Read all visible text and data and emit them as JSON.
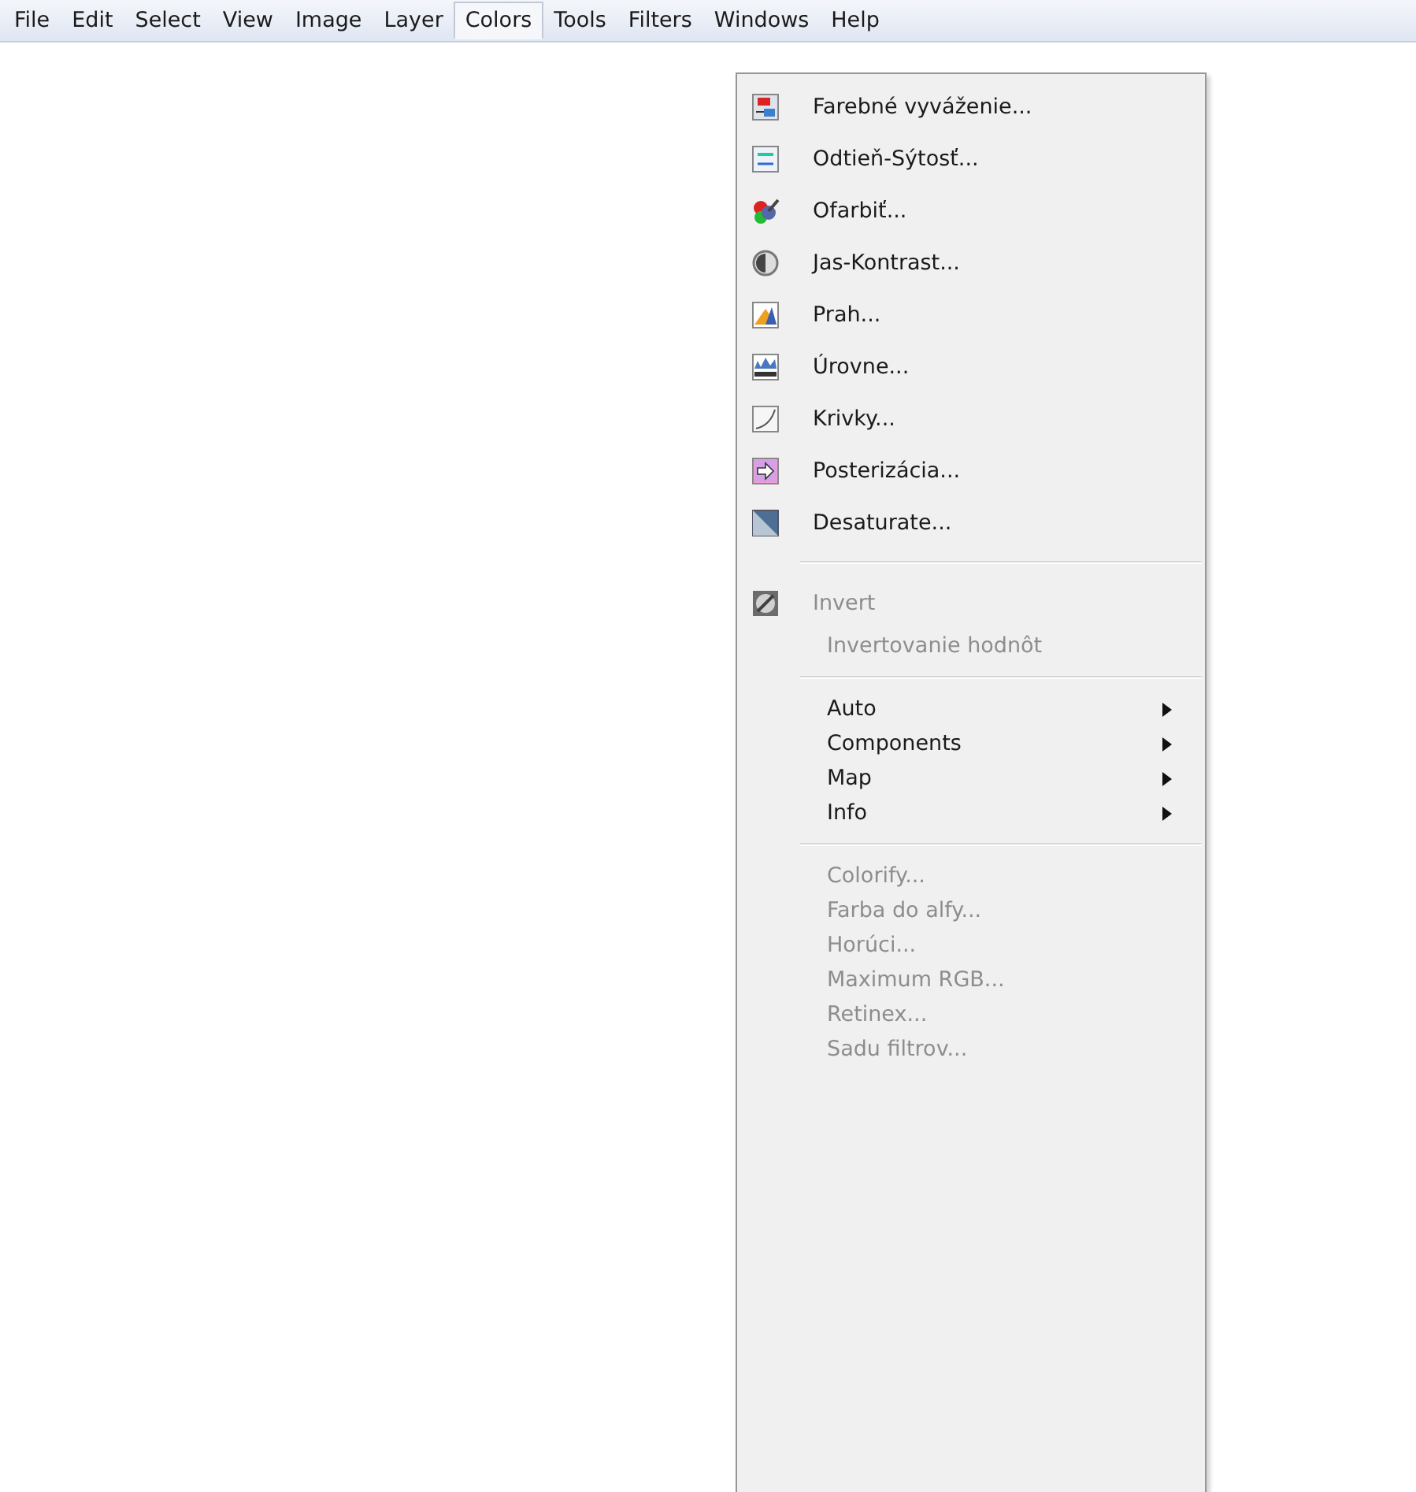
{
  "menubar": [
    {
      "label": "File",
      "selected": false
    },
    {
      "label": "Edit",
      "selected": false
    },
    {
      "label": "Select",
      "selected": false
    },
    {
      "label": "View",
      "selected": false
    },
    {
      "label": "Image",
      "selected": false
    },
    {
      "label": "Layer",
      "selected": false
    },
    {
      "label": "Colors",
      "selected": true
    },
    {
      "label": "Tools",
      "selected": false
    },
    {
      "label": "Filters",
      "selected": false
    },
    {
      "label": "Windows",
      "selected": false
    },
    {
      "label": "Help",
      "selected": false
    }
  ],
  "menu": {
    "groups": [
      [
        {
          "kind": "icon",
          "label": "Farebné vyváženie...",
          "disabled": false
        },
        {
          "kind": "icon",
          "label": "Odtieň-Sýtosť...",
          "disabled": false
        },
        {
          "kind": "icon",
          "label": "Ofarbiť...",
          "disabled": false
        },
        {
          "kind": "icon",
          "label": "Jas-Kontrast...",
          "disabled": false
        },
        {
          "kind": "icon",
          "label": "Prah...",
          "disabled": false
        },
        {
          "kind": "icon",
          "label": "Úrovne...",
          "disabled": false
        },
        {
          "kind": "icon",
          "label": "Krivky...",
          "disabled": false
        },
        {
          "kind": "icon",
          "label": "Posterizácia...",
          "disabled": false
        },
        {
          "kind": "icon",
          "label": "Desaturate...",
          "disabled": false
        }
      ],
      [
        {
          "kind": "icon",
          "label": "Invert",
          "disabled": true
        },
        {
          "kind": "plain",
          "label": "Invertovanie hodnôt",
          "disabled": true
        }
      ],
      [
        {
          "kind": "submenu",
          "label": "Auto",
          "disabled": false
        },
        {
          "kind": "submenu",
          "label": "Components",
          "disabled": false
        },
        {
          "kind": "submenu",
          "label": "Map",
          "disabled": false
        },
        {
          "kind": "submenu",
          "label": "Info",
          "disabled": false
        }
      ],
      [
        {
          "kind": "plain",
          "label": "Colorify...",
          "disabled": true
        },
        {
          "kind": "plain",
          "label": "Farba do alfy...",
          "disabled": true
        },
        {
          "kind": "plain",
          "label": "Horúci...",
          "disabled": true
        },
        {
          "kind": "plain",
          "label": "Maximum RGB...",
          "disabled": true
        },
        {
          "kind": "plain",
          "label": "Retinex...",
          "disabled": true
        },
        {
          "kind": "plain",
          "label": "Sadu filtrov...",
          "disabled": true
        }
      ]
    ]
  }
}
